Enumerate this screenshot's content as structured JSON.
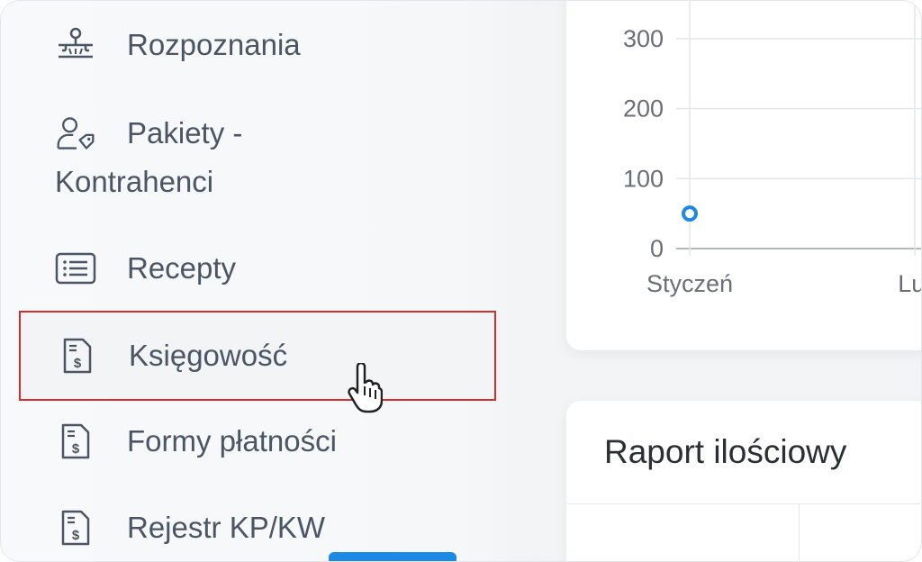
{
  "sidebar": {
    "items": [
      {
        "label": "Rozpoznania",
        "icon": "group-structure-icon"
      },
      {
        "label_line1": "Pakiety -",
        "label_line2": "Kontrahenci",
        "icon": "user-tag-icon"
      },
      {
        "label": "Recepty",
        "icon": "list-icon"
      },
      {
        "label": "Księgowość",
        "icon": "dollar-document-icon",
        "active": true
      },
      {
        "label": "Formy płatności",
        "icon": "dollar-document-icon"
      },
      {
        "label": "Rejestr KP/KW",
        "icon": "dollar-document-icon"
      }
    ]
  },
  "chart_data": {
    "type": "line",
    "categories": [
      "Styczeń",
      "Lut"
    ],
    "y_ticks": [
      "300",
      "200",
      "100",
      "0"
    ],
    "series": [
      {
        "values": [
          50
        ]
      }
    ],
    "ylim": [
      0,
      300
    ],
    "grid": true,
    "point_color": "#1e88e5"
  },
  "report": {
    "title": "Raport ilościowy"
  },
  "colors": {
    "active_border": "#d32f2f",
    "accent": "#1e88e5",
    "text": "#4b5563"
  }
}
